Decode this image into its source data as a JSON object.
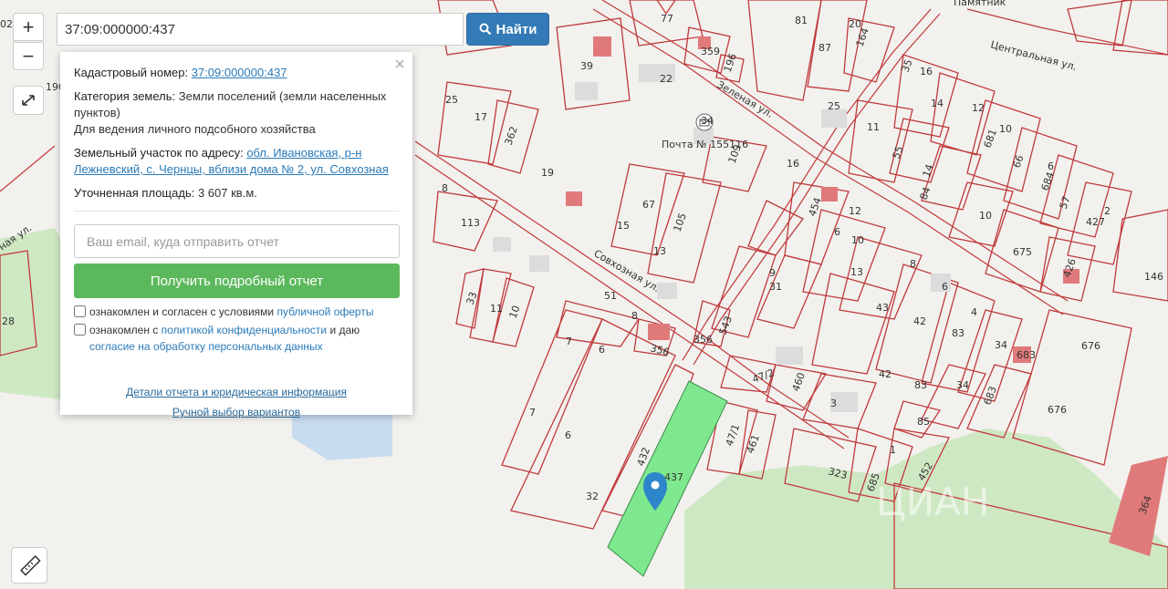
{
  "search": {
    "value": "37:09:000000:437",
    "button_label": "Найти"
  },
  "zoom": {
    "in": "+",
    "out": "−"
  },
  "popup": {
    "close": "×",
    "cadastral_label": "Кадастровый номер:",
    "cadastral_value": "37:09:000000:437",
    "category_label": "Категория земель:",
    "category_value": "Земли поселений (земли населенных пунктов)",
    "usage": "Для ведения личного подсобного хозяйства",
    "address_label": "Земельный участок по адресу:",
    "address_value": "обл. Ивановская, р-н Лежневский, с. Чернцы, вблизи дома № 2, ул. Совхозная",
    "area_label": "Уточненная площадь:",
    "area_value": "3 607 кв.м.",
    "email_placeholder": "Ваш email, куда отправить отчет",
    "report_button": "Получить подробный отчет",
    "agree1_text": "ознакомлен и согласен с условиями ",
    "agree1_link": "публичной оферты",
    "agree2_text": "ознакомлен с ",
    "agree2_link": "политикой конфиденциальности",
    "agree2_text2": " и даю ",
    "agree2_link2": "согласие на обработку персональных данных",
    "details_link": "Детали отчета и юридическая информация",
    "manual_link": "Ручной выбор вариантов"
  },
  "map": {
    "streets": [
      "Центральная ул.",
      "Зеленая ул.",
      "Совхозная ул.",
      "ная ул."
    ],
    "poi": "Почта № 155116",
    "monument": "Памятник",
    "highlight_color": "#7ee88e",
    "plot_color": "#c0393b",
    "watermark": "ЦИАН",
    "plots": [
      "02",
      "190",
      "77",
      "81",
      "20",
      "87",
      "164",
      "359",
      "196",
      "39",
      "22",
      "35",
      "16",
      "14",
      "33",
      "13",
      "12",
      "25",
      "17",
      "362",
      "34",
      "11",
      "55",
      "14",
      "681",
      "10",
      "66",
      "6",
      "684",
      "57",
      "427",
      "19",
      "109",
      "16",
      "454",
      "12",
      "84",
      "10",
      "675",
      "426",
      "2",
      "146",
      "113",
      "8",
      "67",
      "105",
      "15",
      "13",
      "6",
      "10",
      "13",
      "8",
      "31",
      "9",
      "43",
      "42",
      "83",
      "34",
      "683",
      "676",
      "33",
      "11",
      "10",
      "51",
      "8",
      "543",
      "6",
      "4",
      "42",
      "83",
      "34",
      "683",
      "676",
      "356",
      "7",
      "6",
      "47/2",
      "460",
      "3",
      "7",
      "6",
      "47/1",
      "461",
      "85",
      "1",
      "432",
      "437",
      "32",
      "323",
      "685",
      "452",
      "364",
      "28",
      "3",
      "6",
      "8",
      "4",
      "12"
    ]
  }
}
